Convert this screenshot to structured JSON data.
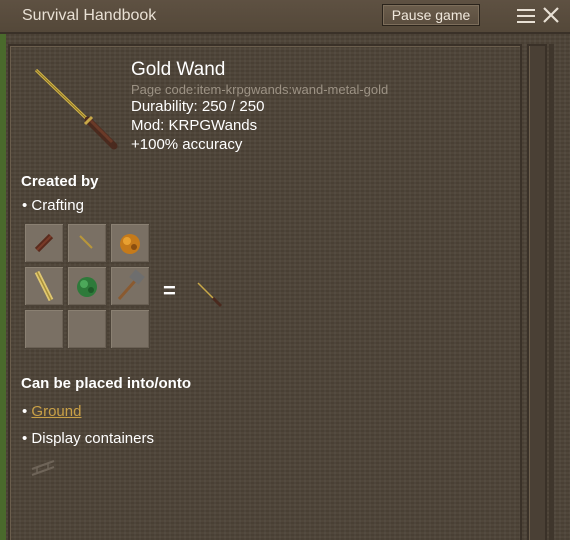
{
  "window": {
    "title": "Survival Handbook",
    "pause_label": "Pause game"
  },
  "icons": {
    "menu": "hamburger-menu-icon",
    "close": "close-icon",
    "item": "gold-wand-icon"
  },
  "item": {
    "name": "Gold Wand",
    "page_code": "Page code:item-krpgwands:wand-metal-gold",
    "durability": "Durability: 250 / 250",
    "mod": "Mod: KRPGWands",
    "bonus": "+100% accuracy"
  },
  "created_by": {
    "heading": "Created by",
    "method": "• Crafting",
    "grid": [
      "wooden-stick-icon",
      "gold-stick-icon",
      "amber-gem-icon",
      "gold-rod-icon",
      "green-gem-icon",
      "hammer-icon",
      "",
      "",
      ""
    ],
    "equals": "=",
    "result": "gold-wand-icon"
  },
  "placement": {
    "heading": "Can be placed into/onto",
    "bullet_prefix": "• ",
    "ground_link": "Ground",
    "display_containers": "• Display containers",
    "icon": "rack-icon"
  },
  "colors": {
    "background": "#4e4438",
    "link": "#c9a046",
    "text": "#ffffff",
    "muted_text": "#9c9284"
  }
}
